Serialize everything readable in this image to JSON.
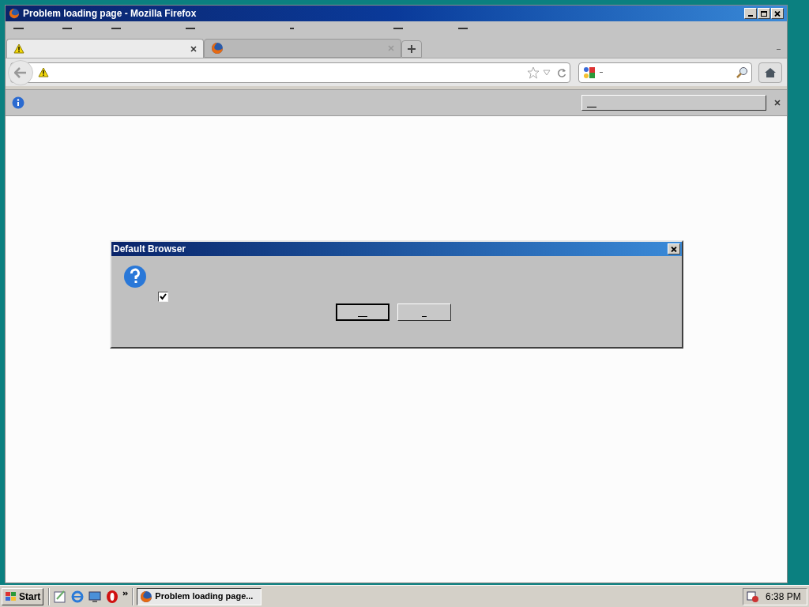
{
  "window": {
    "title": "Problem loading page - Mozilla Firefox"
  },
  "tabs": [
    {
      "kind": "warning",
      "selected": true
    },
    {
      "kind": "firefox",
      "selected": false
    }
  ],
  "dialog": {
    "title": "Default Browser",
    "checkbox": {
      "checked": true
    }
  },
  "taskbar": {
    "start": "Start",
    "tasks": [
      {
        "label": "Problem loading page...",
        "selected": true
      }
    ],
    "clock": "6:38 PM"
  }
}
